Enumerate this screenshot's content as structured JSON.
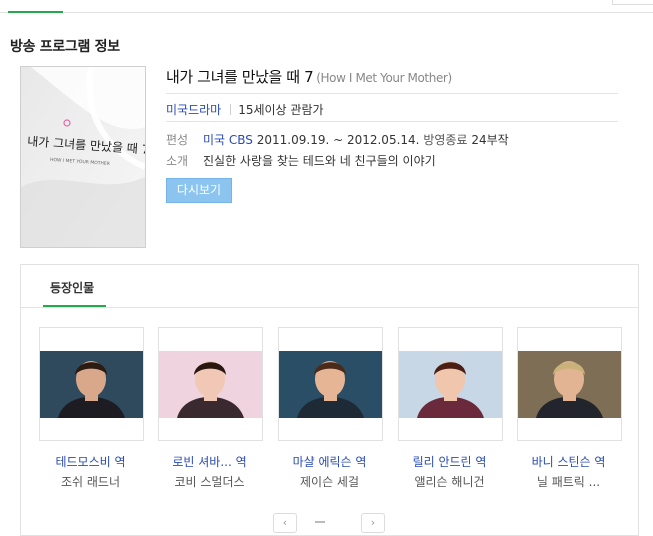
{
  "section_title": "방송 프로그램 정보",
  "poster": {
    "title_text": "내가 그녀를 만났을 때 7",
    "sub_text": "HOW I MET YOUR MOTHER"
  },
  "program": {
    "title": "내가 그녀를 만났을 때 7",
    "eng_title": "(How I Met Your Mother)",
    "genre": "미국드라마",
    "rating": "15세이상 관람가",
    "pyeonseong_label": "편성",
    "channel": "미국 CBS",
    "period": "2011.09.19. ~ 2012.05.14.",
    "status": "방영종료",
    "episodes": "24부작",
    "sogae_label": "소개",
    "summary": "진실한 사랑을 찾는 테드와 네 친구들의 이야기",
    "rewatch_button": "다시보기"
  },
  "cast": {
    "tab_label": "등장인물",
    "members": [
      {
        "role": "테드모스비 역",
        "actor": "조쉬 래드너",
        "bg": "#2f4a5c",
        "skin": "#d9a88a",
        "hair": "#2b1b12",
        "cloth": "#1c1c22"
      },
      {
        "role": "로빈 셔바... 역",
        "actor": "코비 스멀더스",
        "bg": "#efd4df",
        "skin": "#f0c8b5",
        "hair": "#2a1610",
        "cloth": "#3a2a30"
      },
      {
        "role": "마샬 에릭슨 역",
        "actor": "제이슨 세걸",
        "bg": "#2a4e66",
        "skin": "#e6b596",
        "hair": "#4a2a18",
        "cloth": "#1e2a36"
      },
      {
        "role": "릴리 안드린 역",
        "actor": "앨리슨 해니건",
        "bg": "#c7d7e6",
        "skin": "#f0c6ad",
        "hair": "#4a1e14",
        "cloth": "#6a2a3c"
      },
      {
        "role": "바니 스틴슨 역",
        "actor": "닐 패트릭 ...",
        "bg": "#7e6e55",
        "skin": "#e2b493",
        "hair": "#c9b27a",
        "cloth": "#22262c"
      }
    ],
    "pager_prev": "‹",
    "pager_next": "›"
  },
  "colors": {
    "accent_green": "#24a94b",
    "link_blue": "#2a4bb5",
    "button_blue": "#8cc4f0"
  }
}
